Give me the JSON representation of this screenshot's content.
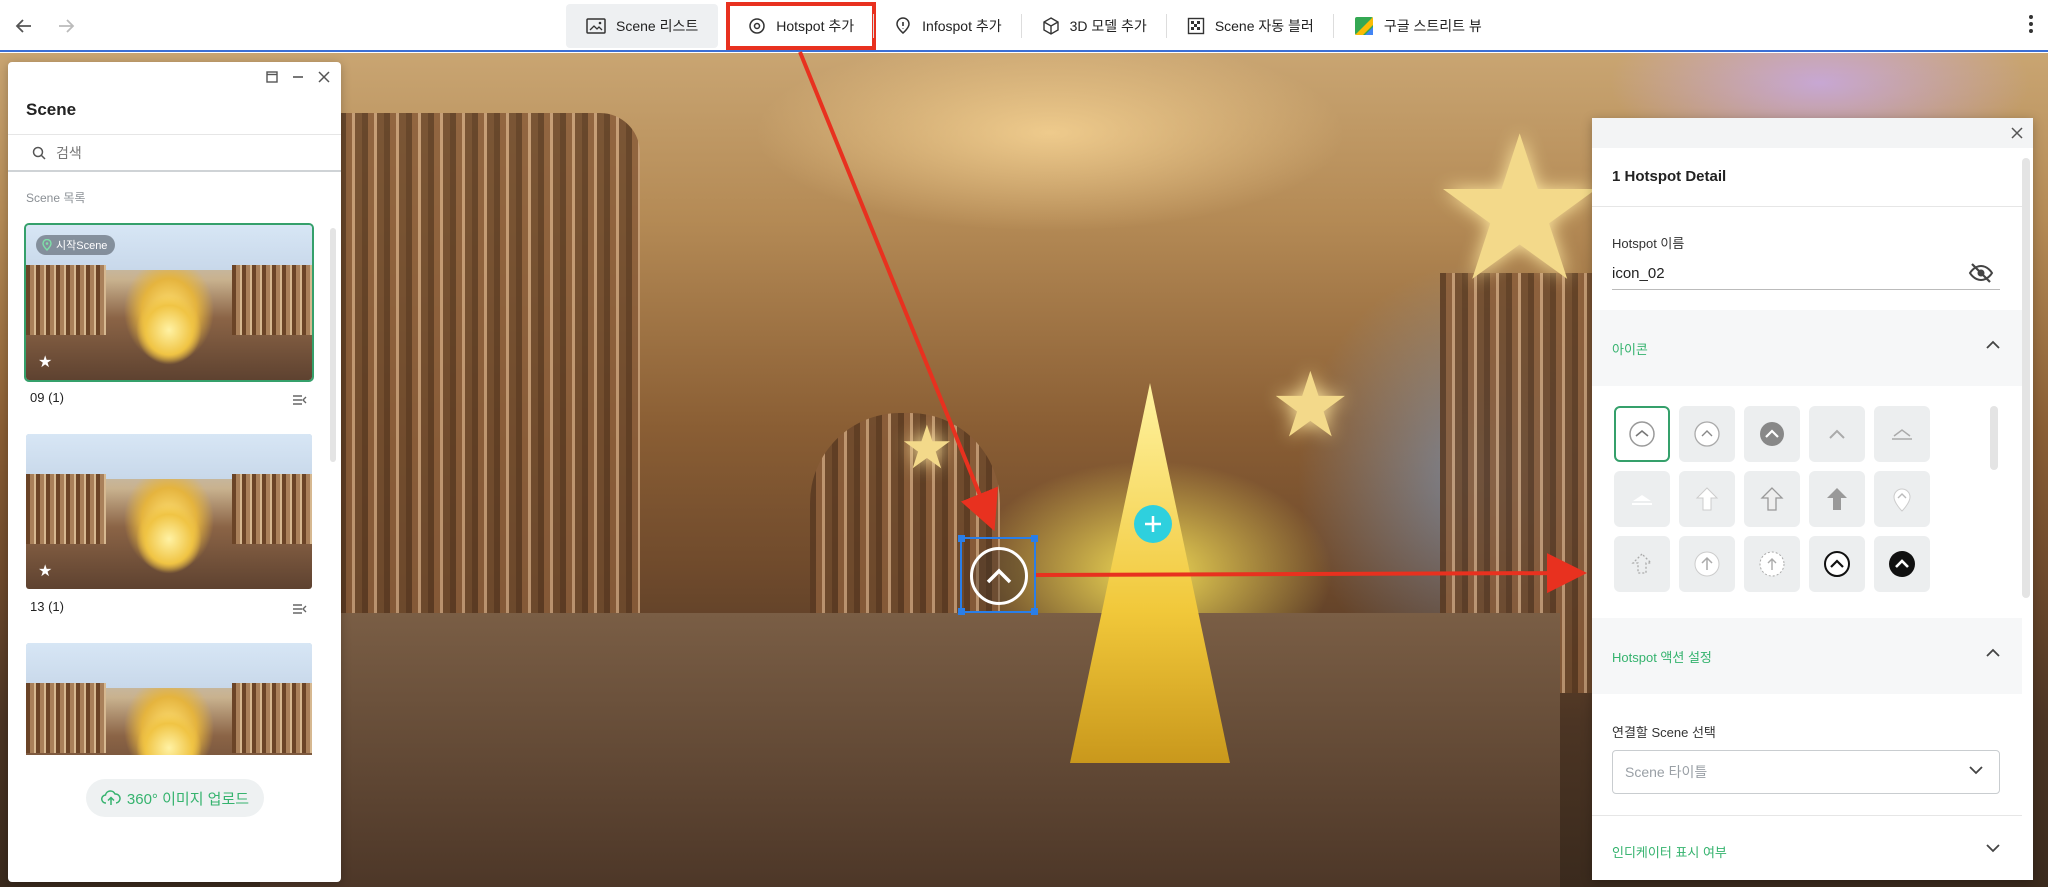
{
  "toolbar": {
    "items": [
      {
        "label": "Scene 리스트",
        "icon": "image-list-icon"
      },
      {
        "label": "Hotspot 추가",
        "icon": "hotspot-target-icon"
      },
      {
        "label": "Infospot 추가",
        "icon": "info-pin-icon"
      },
      {
        "label": "3D 모델 추가",
        "icon": "cube-icon"
      },
      {
        "label": "Scene 자동 블러",
        "icon": "blur-grid-icon"
      },
      {
        "label": "구글 스트리트 뷰",
        "icon": "google-maps-icon"
      }
    ]
  },
  "scene_panel": {
    "title": "Scene",
    "search_placeholder": "검색",
    "list_label": "Scene 목록",
    "scenes": [
      {
        "name": "09 (1)",
        "badge": "시작Scene"
      },
      {
        "name": "13 (1)"
      },
      {
        "name": ""
      }
    ],
    "upload_label": "360° 이미지 업로드"
  },
  "detail_panel": {
    "title": "1 Hotspot Detail",
    "name_label": "Hotspot 이름",
    "name_value": "icon_02",
    "icon_section": "아이콘",
    "action_section": "Hotspot 액션 설정",
    "link_scene_label": "연결할 Scene 선택",
    "link_scene_placeholder": "Scene 타이틀",
    "indicator_section": "인디케이터 표시 여부",
    "icons": [
      "circle-chevron-up-icon",
      "circle-chevron-up-light-icon",
      "circle-chevron-up-filled-icon",
      "chevron-up-icon",
      "chevron-up-bar-icon",
      "triangle-bar-icon",
      "arrow-up-icon",
      "arrow-up-outline-icon",
      "arrow-up-filled-icon",
      "map-pin-icon",
      "arrow-up-dashed-icon",
      "circle-arrow-up-icon",
      "circle-arrow-up-dashed-icon",
      "circle-chevron-up-dark-icon",
      "circle-chevron-up-solid-icon"
    ]
  },
  "colors": {
    "accent": "#35b36e",
    "highlight": "#e8311f",
    "selection": "#2a7ee8",
    "marker": "#2ed0de"
  }
}
